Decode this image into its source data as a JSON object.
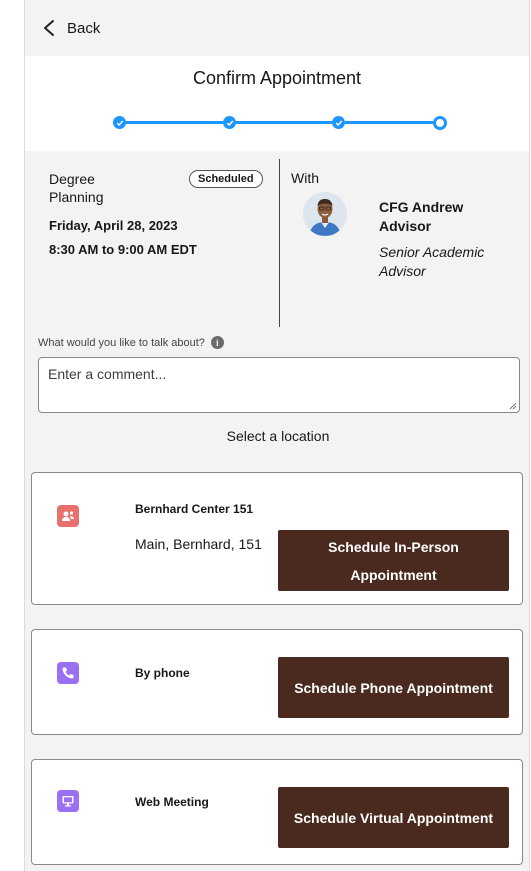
{
  "nav": {
    "back_label": "Back"
  },
  "header": {
    "title": "Confirm Appointment",
    "steps_total": 4,
    "steps_completed": 3
  },
  "appointment": {
    "topic": "Degree Planning",
    "status": "Scheduled",
    "date": "Friday, April 28, 2023",
    "time": "8:30 AM to 9:00 AM EDT",
    "with_label": "With",
    "advisor_name": "CFG Andrew Advisor",
    "advisor_title": "Senior Academic Advisor"
  },
  "comment": {
    "label": "What would you like to talk about?",
    "placeholder": "Enter a comment..."
  },
  "locations": {
    "heading": "Select a location",
    "items": [
      {
        "icon": "person-location-icon",
        "color": "#e8716d",
        "name": "Bernhard Center 151",
        "address": "Main, Bernhard, 151",
        "button": "Schedule In-Person Appointment"
      },
      {
        "icon": "phone-icon",
        "color": "#9b6ff2",
        "name": "By phone",
        "button": "Schedule Phone Appointment"
      },
      {
        "icon": "monitor-icon",
        "color": "#9b6ff2",
        "name": "Web Meeting",
        "button": "Schedule Virtual Appointment"
      }
    ]
  },
  "colors": {
    "accent": "#1b96ff",
    "button_bg": "#4a2a1f"
  }
}
